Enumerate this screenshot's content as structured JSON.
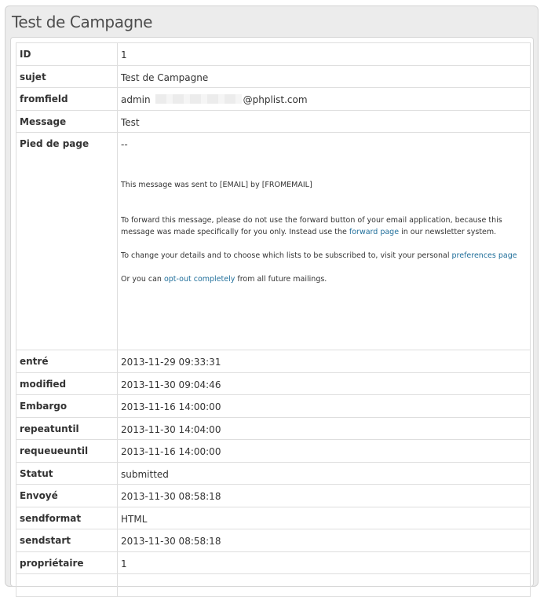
{
  "page_title": "Test de Campagne",
  "rows": {
    "id": {
      "label": "ID",
      "value": "1"
    },
    "sujet": {
      "label": "sujet",
      "value": "Test de Campagne"
    },
    "fromfield": {
      "label": "fromfield",
      "value_prefix": "admin",
      "value_suffix": "@phplist.com"
    },
    "message": {
      "label": "Message",
      "value": "Test"
    },
    "pied": {
      "label": "Pied de page",
      "dash": "--",
      "sent_line": "This message was sent to [EMAIL] by [FROMEMAIL]",
      "forward_before": "To forward this message, please do not use the forward button of your email application, because this message was made specifically for you only. Instead use the ",
      "forward_link": "forward page",
      "forward_after": " in our newsletter system.",
      "change_before": "To change your details and to choose which lists to be subscribed to, visit your personal ",
      "change_link": "preferences page",
      "optout_before": "Or you can ",
      "optout_link": "opt-out completely",
      "optout_after": " from all future mailings."
    },
    "entre": {
      "label": "entré",
      "value": "2013-11-29 09:33:31"
    },
    "modified": {
      "label": "modified",
      "value": "2013-11-30 09:04:46"
    },
    "embargo": {
      "label": "Embargo",
      "value": "2013-11-16 14:00:00"
    },
    "repeatuntil": {
      "label": "repeatuntil",
      "value": "2013-11-30 14:04:00"
    },
    "requeueuntil": {
      "label": "requeueuntil",
      "value": "2013-11-16 14:00:00"
    },
    "statut": {
      "label": "Statut",
      "value": "submitted"
    },
    "envoye": {
      "label": "Envoyé",
      "value": "2013-11-30 08:58:18"
    },
    "sendformat": {
      "label": "sendformat",
      "value": "HTML"
    },
    "sendstart": {
      "label": "sendstart",
      "value": "2013-11-30 08:58:18"
    },
    "proprietaire": {
      "label": "propriétaire",
      "value": "1"
    }
  },
  "colors": {
    "link": "#1f6e9a",
    "panel_bg": "#ececec",
    "text": "#333333"
  }
}
